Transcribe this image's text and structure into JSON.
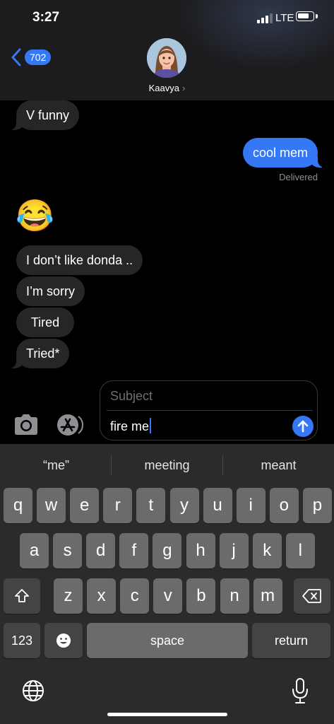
{
  "status_bar": {
    "time": "3:27",
    "network": "LTE",
    "battery_percent": 80,
    "signal_bars": 3
  },
  "header": {
    "back_count": "702",
    "contact_name": "Kaavya",
    "contact_chevron": "›"
  },
  "messages": [
    {
      "text": "V funny",
      "side": "received"
    },
    {
      "text": "cool mem",
      "side": "sent"
    },
    {
      "text": "😂",
      "side": "received",
      "kind": "emoji"
    },
    {
      "text": "I don’t like donda ..",
      "side": "received"
    },
    {
      "text": "I’m sorry",
      "side": "received"
    },
    {
      "text": "Tired",
      "side": "received"
    },
    {
      "text": "Tried*",
      "side": "received"
    }
  ],
  "delivery_status": "Delivered",
  "composer": {
    "subject_placeholder": "Subject",
    "text": "fire me"
  },
  "keyboard": {
    "suggestions": [
      "“me”",
      "meeting",
      "meant"
    ],
    "row1": [
      "q",
      "w",
      "e",
      "r",
      "t",
      "y",
      "u",
      "i",
      "o",
      "p"
    ],
    "row2": [
      "a",
      "s",
      "d",
      "f",
      "g",
      "h",
      "j",
      "k",
      "l"
    ],
    "row3": [
      "z",
      "x",
      "c",
      "v",
      "b",
      "n",
      "m"
    ],
    "numbers_key": "123",
    "space_key": "space",
    "return_key": "return"
  },
  "icons": {
    "back": "chevron-left-icon",
    "camera": "camera-icon",
    "apps": "app-store-icon",
    "send": "arrow-up-icon",
    "shift": "shift-icon",
    "delete": "delete-icon",
    "emoji": "emoji-icon",
    "globe": "globe-icon",
    "mic": "microphone-icon"
  },
  "colors": {
    "accent": "#3478f6",
    "received_bubble": "#262628",
    "header_bg": "#1c1c1e",
    "keyboard_bg": "#2b2b2d"
  }
}
